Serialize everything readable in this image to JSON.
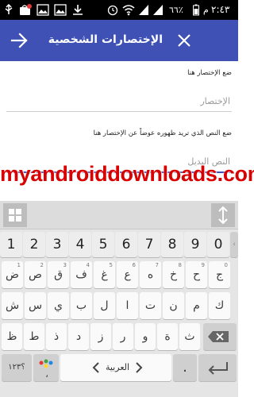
{
  "status_bar": {
    "time": "٢:٤٣",
    "am_pm": "م",
    "battery": "٦٦٪"
  },
  "app_bar": {
    "title": "الإختصارات الشخصية",
    "close_icon": "close-icon",
    "confirm_icon": "arrow-right-icon"
  },
  "form": {
    "shortcut_label": "ضع الإختصار هنا",
    "shortcut_placeholder": "الإختصار",
    "replacement_label": "ضع النص الذي تريد ظهوره عوضاً عن الإختصار هنا",
    "replacement_placeholder": "النص البديل"
  },
  "watermark": "myandroiddownloads.com",
  "keyboard": {
    "numbers": [
      "1",
      "2",
      "3",
      "4",
      "5",
      "6",
      "7",
      "8",
      "9",
      "0"
    ],
    "row1": [
      {
        "main": "ض",
        "hint": "1"
      },
      {
        "main": "ص",
        "hint": "2"
      },
      {
        "main": "ق",
        "hint": "3"
      },
      {
        "main": "ف",
        "hint": "4"
      },
      {
        "main": "غ",
        "hint": "5"
      },
      {
        "main": "ع",
        "hint": "6"
      },
      {
        "main": "ه",
        "hint": "7"
      },
      {
        "main": "خ",
        "hint": "8"
      },
      {
        "main": "ح",
        "hint": "9"
      },
      {
        "main": "ج",
        "hint": "0"
      }
    ],
    "row2": [
      "ش",
      "س",
      "ي",
      "ب",
      "ل",
      "ا",
      "ت",
      "ن",
      "م",
      "ك"
    ],
    "row3": [
      "ظ",
      "ط",
      "ذ",
      "د",
      "ز",
      "ر",
      "و",
      "ة",
      "ث"
    ],
    "symbols_label": "؟١٢٣",
    "comma_label": "،",
    "language_label": "العربية",
    "period_label": ".",
    "enter_icon": "enter-icon",
    "backspace_icon": "backspace-icon",
    "grid_icon": "grid-icon",
    "cursor_icon": "cursor-move-icon",
    "colors": {
      "key_bg": "#fafafa",
      "board_bg": "#e5e5e5",
      "accent": "#3F51B5"
    }
  }
}
